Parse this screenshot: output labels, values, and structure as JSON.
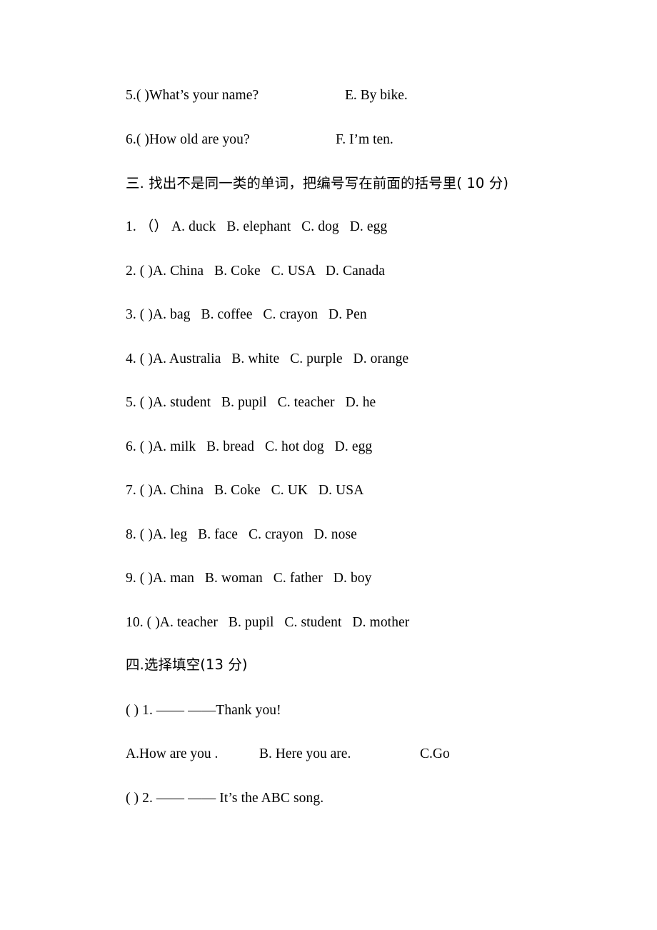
{
  "document": {
    "type": "exam-worksheet",
    "language": "zh-CN + en",
    "background_color": "#ffffff",
    "text_color": "#000000"
  },
  "matching_section": {
    "items": [
      {
        "prompt": "5.( )What’s your name?",
        "answer": "E. By bike."
      },
      {
        "prompt": "6.( )How old are you?",
        "answer": "F. I’m ten."
      }
    ]
  },
  "section_three": {
    "heading": "三. 找出不是同一类的单词，把编号写在前面的括号里( 10 分)",
    "items": [
      "1. （） A. duck   B. elephant   C. dog   D. egg",
      "2. ( )A. China   B. Coke   C. USA   D. Canada",
      "3. ( )A. bag   B. coffee   C. crayon   D. Pen",
      "4. ( )A. Australia   B. white   C. purple   D. orange",
      "5. ( )A. student   B. pupil   C. teacher   D. he",
      "6. ( )A. milk   B. bread   C. hot dog   D. egg",
      "7. ( )A. China   B. Coke   C. UK   D. USA",
      "8. ( )A. leg   B. face   C. crayon   D. nose",
      "9. ( )A. man   B. woman   C. father   D. boy",
      "10. ( )A. teacher   B. pupil   C. student   D. mother"
    ]
  },
  "section_four": {
    "heading": "四.选择填空(13 分)",
    "questions": [
      {
        "stem": "( ) 1. —— ——Thank you!",
        "options": [
          "A.How are you .",
          "B. Here you are.",
          "C.Go"
        ]
      },
      {
        "stem": "( ) 2. —— —— It’s the ABC song.",
        "options": []
      }
    ]
  }
}
